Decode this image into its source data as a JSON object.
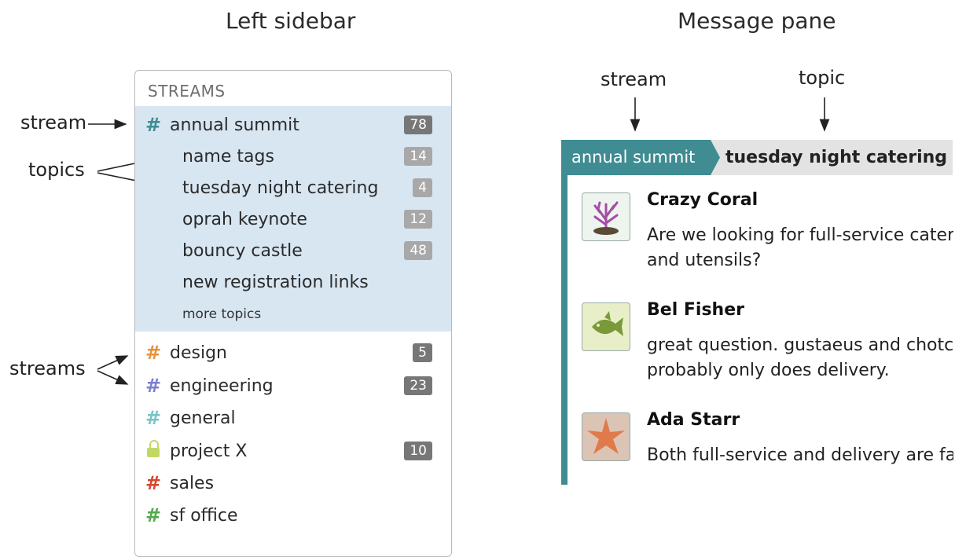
{
  "headings": {
    "left": "Left sidebar",
    "right": "Message pane"
  },
  "annotations": {
    "stream": "stream",
    "topics": "topics",
    "streams": "streams",
    "pane_stream": "stream",
    "pane_topic": "topic"
  },
  "sidebar": {
    "header": "STREAMS",
    "active_stream": {
      "name": "annual summit",
      "count": "78",
      "color": "#3f8c92"
    },
    "topics": [
      {
        "name": "name tags",
        "count": "14"
      },
      {
        "name": "tuesday night catering",
        "count": "4"
      },
      {
        "name": "oprah keynote",
        "count": "12"
      },
      {
        "name": "bouncy castle",
        "count": "48"
      },
      {
        "name": "new registration links",
        "count": ""
      }
    ],
    "more_topics": "more topics",
    "streams": [
      {
        "name": "design",
        "count": "5",
        "color": "#e8913a",
        "icon": "hash-icon"
      },
      {
        "name": "engineering",
        "count": "23",
        "color": "#7b7fcf",
        "icon": "hash-icon"
      },
      {
        "name": "general",
        "count": "",
        "color": "#76c4c7",
        "icon": "hash-icon"
      },
      {
        "name": "project X",
        "count": "10",
        "color": "#c2d865",
        "icon": "lock-icon"
      },
      {
        "name": "sales",
        "count": "",
        "color": "#d6462f",
        "icon": "hash-icon"
      },
      {
        "name": "sf office",
        "count": "",
        "color": "#53a94b",
        "icon": "hash-icon"
      }
    ]
  },
  "message_pane": {
    "stream": "annual summit",
    "topic": "tuesday night catering",
    "accent_color": "#3f8c92",
    "messages": [
      {
        "sender": "Crazy Coral",
        "avatar": "coral-icon",
        "lines": [
          "Are we looking for full-service cateri",
          "and utensils?"
        ]
      },
      {
        "sender": "Bel Fisher",
        "avatar": "fish-icon",
        "lines": [
          "great question. gustaeus and chotch",
          "probably only does delivery."
        ]
      },
      {
        "sender": "Ada Starr",
        "avatar": "starfish-icon",
        "lines": [
          "Both full-service and delivery are fai"
        ]
      }
    ]
  }
}
